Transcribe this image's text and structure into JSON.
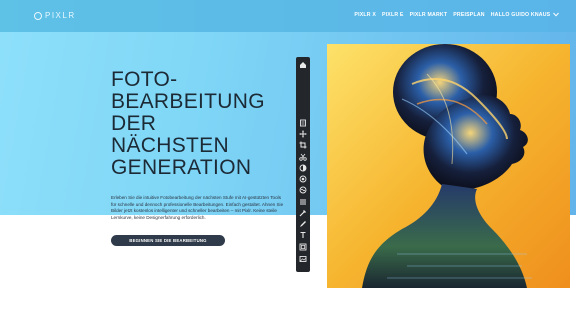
{
  "logo": {
    "text": "PIXLR"
  },
  "nav": {
    "items": [
      "PIXLR X",
      "PIXLR E",
      "PIXLR MARKT",
      "PREISPLAN",
      "HALLO GUIDO KNAUS"
    ],
    "dropdown_icon": "chevron-down-icon"
  },
  "hero": {
    "headline": [
      "FOTO-",
      "BEARBEITUNG",
      "DER",
      "NÄCHSTEN",
      "GENERATION"
    ],
    "description": "Erleben Sie die intuitive Fotobearbeitung der nächsten Stufe mit AI-gestützten Tools für schnelle und dennoch professionelle Bearbeitungen. Einfach gestaltet. Ahnen Sie Bilder jetzt kostenlos intelligenter und schneller bearbeiten – mit Pixlr. Keine steile Lernkurve, keine Designerfahrung erforderlich.",
    "cta_label": "BEGINNEN SIE DIE BEARBEITUNG"
  },
  "toolbar": {
    "tools": [
      "home-icon",
      "arrange-icon",
      "move-icon",
      "crop-icon",
      "cutout-icon",
      "adjust-icon",
      "filter-icon",
      "liquify-icon",
      "layers-icon",
      "retouch-icon",
      "draw-icon",
      "text-icon",
      "frame-icon",
      "image-icon"
    ]
  },
  "colors": {
    "hero_start": "#8ee0fa",
    "hero_end": "#62b4ea",
    "topbar": "#5ab4e8",
    "headline": "#1c2a36",
    "cta_bg": "#2f3b4a",
    "toolbar_bg": "#23262b",
    "photo_warm": "#f4a928"
  }
}
